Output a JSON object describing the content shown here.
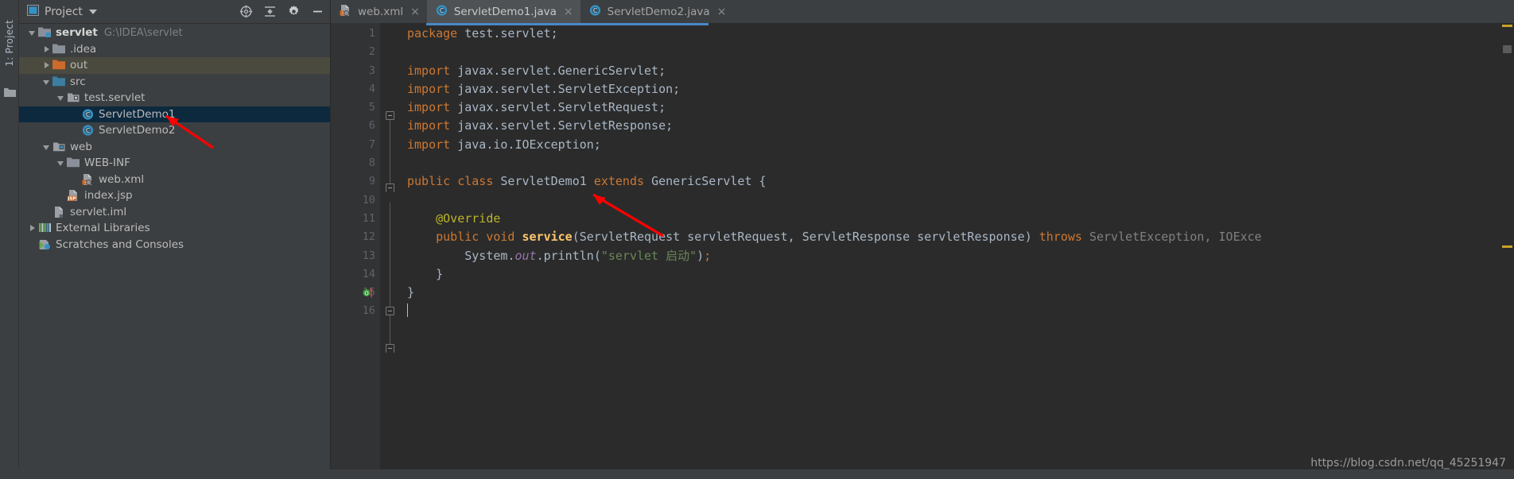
{
  "window": {
    "left_tool_tab": "1: Project",
    "watermark": "https://blog.csdn.net/qq_45251947"
  },
  "project_panel": {
    "title": "Project",
    "icons": {
      "panel": "project-panel-icon",
      "dropdown": "chevron-down-icon",
      "locate": "scroll-from-source-icon",
      "collapse": "collapse-all-icon",
      "settings": "gear-icon",
      "hide": "minimize-icon"
    },
    "tree": [
      {
        "label": "servlet",
        "path": "G:\\IDEA\\servlet",
        "indent": 0,
        "arrow": "down",
        "icon": "module-folder-icon",
        "state": "normal",
        "bold": true
      },
      {
        "label": ".idea",
        "path": "",
        "indent": 1,
        "arrow": "right",
        "icon": "folder-icon",
        "state": "normal",
        "bold": false
      },
      {
        "label": "out",
        "path": "",
        "indent": 1,
        "arrow": "right",
        "icon": "folder-orange-icon",
        "state": "hover",
        "bold": false
      },
      {
        "label": "src",
        "path": "",
        "indent": 1,
        "arrow": "down",
        "icon": "source-folder-icon",
        "state": "normal",
        "bold": false
      },
      {
        "label": "test.servlet",
        "path": "",
        "indent": 2,
        "arrow": "down",
        "icon": "package-icon",
        "state": "normal",
        "bold": false
      },
      {
        "label": "ServletDemo1",
        "path": "",
        "indent": 3,
        "arrow": "none",
        "icon": "java-class-icon",
        "state": "selected",
        "bold": false
      },
      {
        "label": "ServletDemo2",
        "path": "",
        "indent": 3,
        "arrow": "none",
        "icon": "java-class-icon",
        "state": "normal",
        "bold": false
      },
      {
        "label": "web",
        "path": "",
        "indent": 1,
        "arrow": "down",
        "icon": "web-folder-icon",
        "state": "normal",
        "bold": false
      },
      {
        "label": "WEB-INF",
        "path": "",
        "indent": 2,
        "arrow": "down",
        "icon": "folder-icon",
        "state": "normal",
        "bold": false
      },
      {
        "label": "web.xml",
        "path": "",
        "indent": 3,
        "arrow": "none",
        "icon": "xml-file-icon",
        "state": "normal",
        "bold": false
      },
      {
        "label": "index.jsp",
        "path": "",
        "indent": 2,
        "arrow": "none",
        "icon": "jsp-file-icon",
        "state": "normal",
        "bold": false
      },
      {
        "label": "servlet.iml",
        "path": "",
        "indent": 1,
        "arrow": "none",
        "icon": "iml-file-icon",
        "state": "normal",
        "bold": false
      },
      {
        "label": "External Libraries",
        "path": "",
        "indent": 0,
        "arrow": "right",
        "icon": "libraries-icon",
        "state": "normal",
        "bold": false
      },
      {
        "label": "Scratches and Consoles",
        "path": "",
        "indent": 0,
        "arrow": "none",
        "icon": "scratches-icon",
        "state": "normal",
        "bold": false
      }
    ]
  },
  "editor": {
    "tabs": [
      {
        "label": "web.xml",
        "icon": "xml-file-icon",
        "active": false,
        "close": "×"
      },
      {
        "label": "ServletDemo1.java",
        "icon": "java-class-icon",
        "active": true,
        "close": "×"
      },
      {
        "label": "ServletDemo2.java",
        "icon": "java-class-icon",
        "active": false,
        "close": "×"
      }
    ],
    "line_numbers": [
      "1",
      "2",
      "3",
      "4",
      "5",
      "6",
      "7",
      "8",
      "9",
      "10",
      "11",
      "12",
      "13",
      "14",
      "15",
      "16"
    ],
    "lines": [
      {
        "n": "1",
        "text": "package test.servlet;"
      },
      {
        "n": "2",
        "text": ""
      },
      {
        "n": "3",
        "text": "import javax.servlet.GenericServlet;"
      },
      {
        "n": "4",
        "text": "import javax.servlet.ServletException;"
      },
      {
        "n": "5",
        "text": "import javax.servlet.ServletRequest;"
      },
      {
        "n": "6",
        "text": "import javax.servlet.ServletResponse;"
      },
      {
        "n": "7",
        "text": "import java.io.IOException;"
      },
      {
        "n": "8",
        "text": ""
      },
      {
        "n": "9",
        "text": "public class ServletDemo1 extends GenericServlet {"
      },
      {
        "n": "10",
        "text": ""
      },
      {
        "n": "11",
        "text": "    @Override"
      },
      {
        "n": "12",
        "text": "    public void service(ServletRequest servletRequest, ServletResponse servletResponse) throws ServletException, IOExce"
      },
      {
        "n": "13",
        "text": "        System.out.println(\"servlet 启动\");"
      },
      {
        "n": "14",
        "text": "    }"
      },
      {
        "n": "15",
        "text": "}"
      },
      {
        "n": "16",
        "text": ""
      }
    ],
    "tokens": {
      "package": "package",
      "pkg_name": "test.servlet;",
      "import": "import",
      "imp3": "javax.servlet.GenericServlet;",
      "imp4": "javax.servlet.ServletException;",
      "imp5": "javax.servlet.ServletRequest;",
      "imp6": "javax.servlet.ServletResponse;",
      "imp7": "java.io.IOException;",
      "public": "public",
      "class": "class",
      "classname": "ServletDemo1",
      "extends": "extends",
      "superclass": "GenericServlet",
      "brace_open": "{",
      "override": "@Override",
      "void": "void",
      "method": "service",
      "param_type1": "ServletRequest",
      "param_name1": "servletRequest",
      "param_type2": "ServletResponse",
      "param_name2": "servletResponse",
      "throws": "throws",
      "exceptions": "ServletException, IOExce",
      "system": "System",
      "out": "out",
      "println": "println",
      "string_literal": "\"servlet 启动\"",
      "brace_close": "}",
      "gutter_override_icon": "override-method-icon"
    }
  },
  "colors": {
    "keyword": "#cc7832",
    "string": "#6a8759",
    "annotation": "#bbb529",
    "method": "#ffc66d",
    "field": "#9876aa",
    "default_text": "#a9b7c6",
    "dimmed": "#808080",
    "selection": "#0d293e",
    "accent_blue": "#4a88c7",
    "annotation_arrow": "#ff0000"
  },
  "annotations": [
    {
      "name": "arrow-to-servletdemo1",
      "color": "#ff0000"
    },
    {
      "name": "arrow-to-genericservlet",
      "color": "#ff0000"
    }
  ]
}
